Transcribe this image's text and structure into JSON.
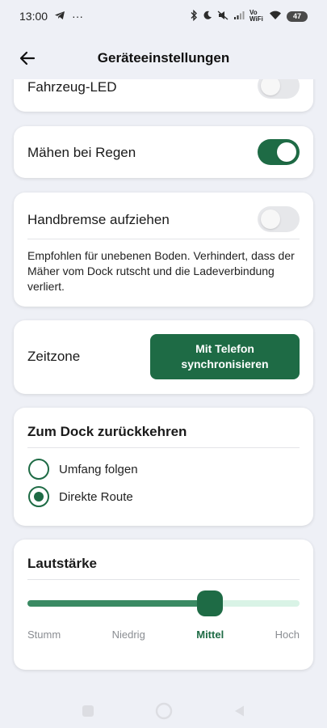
{
  "status_bar": {
    "time": "13:00",
    "left_icons": [
      "telegram-icon",
      "more-dots-icon"
    ],
    "dots": "···",
    "right_icons": [
      "bluetooth-icon",
      "moon-icon",
      "mute-icon",
      "signal-icon",
      "volte-wifi-icon",
      "wifi-icon",
      "battery-icon"
    ],
    "vowifi_text": "Vo WiFi",
    "battery_level": "47"
  },
  "app_bar": {
    "title": "Geräteeinstellungen",
    "back_icon": "arrow-left-icon"
  },
  "settings": {
    "vehicle_led": {
      "label": "Fahrzeug-LED",
      "enabled": false
    },
    "mow_in_rain": {
      "label": "Mähen bei Regen",
      "enabled": true
    },
    "handbrake": {
      "label": "Handbremse aufziehen",
      "enabled": false,
      "description": "Empfohlen für unebenen Boden. Verhindert, dass der Mäher vom Dock rutscht und die Ladeverbindung verliert."
    },
    "timezone": {
      "label": "Zeitzone",
      "button_label": "Mit Telefon synchronisieren"
    },
    "return_to_dock": {
      "title": "Zum Dock zurückkehren",
      "options": [
        {
          "label": "Umfang folgen",
          "selected": false
        },
        {
          "label": "Direkte Route",
          "selected": true
        }
      ]
    },
    "volume": {
      "title": "Lautstärke",
      "levels": [
        "Stumm",
        "Niedrig",
        "Mittel",
        "Hoch"
      ],
      "selected_level": "Mittel",
      "value_fraction": 0.67
    }
  },
  "colors": {
    "accent": "#1e6b45",
    "slider_fill": "#3a8a63",
    "slider_track": "#d9f3e6",
    "background": "#eef0f6"
  },
  "nav_bar": {
    "icons": [
      "recent-apps-icon",
      "home-icon",
      "back-triangle-icon"
    ]
  }
}
